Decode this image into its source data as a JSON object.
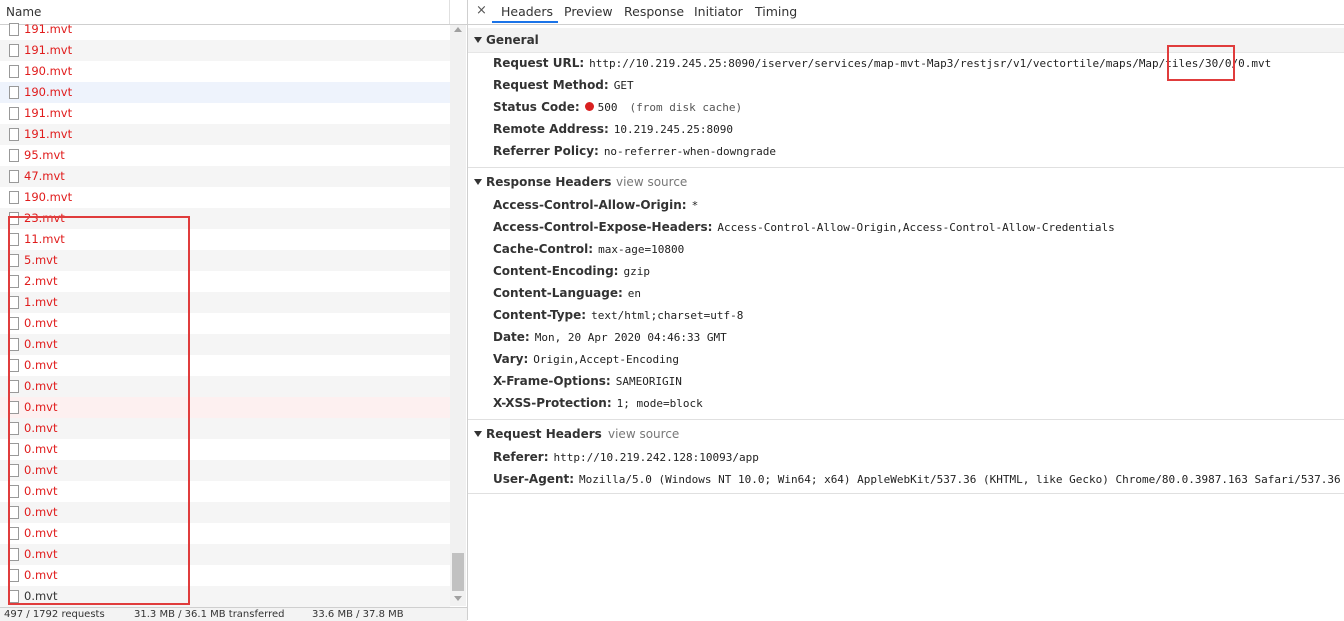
{
  "network_list": {
    "column_name": "Name",
    "files": [
      {
        "name": "191.mvt",
        "style": "red"
      },
      {
        "name": "191.mvt",
        "style": "red"
      },
      {
        "name": "190.mvt",
        "style": "red"
      },
      {
        "name": "190.mvt",
        "style": "red-selected"
      },
      {
        "name": "191.mvt",
        "style": "red"
      },
      {
        "name": "191.mvt",
        "style": "red"
      },
      {
        "name": "95.mvt",
        "style": "red"
      },
      {
        "name": "47.mvt",
        "style": "red"
      },
      {
        "name": "190.mvt",
        "style": "red"
      },
      {
        "name": "23.mvt",
        "style": "red"
      },
      {
        "name": "11.mvt",
        "style": "red"
      },
      {
        "name": "5.mvt",
        "style": "red"
      },
      {
        "name": "2.mvt",
        "style": "red"
      },
      {
        "name": "1.mvt",
        "style": "red"
      },
      {
        "name": "0.mvt",
        "style": "red"
      },
      {
        "name": "0.mvt",
        "style": "red"
      },
      {
        "name": "0.mvt",
        "style": "red"
      },
      {
        "name": "0.mvt",
        "style": "red"
      },
      {
        "name": "0.mvt",
        "style": "red-error"
      },
      {
        "name": "0.mvt",
        "style": "red"
      },
      {
        "name": "0.mvt",
        "style": "red"
      },
      {
        "name": "0.mvt",
        "style": "red"
      },
      {
        "name": "0.mvt",
        "style": "red"
      },
      {
        "name": "0.mvt",
        "style": "red"
      },
      {
        "name": "0.mvt",
        "style": "red"
      },
      {
        "name": "0.mvt",
        "style": "red"
      },
      {
        "name": "0.mvt",
        "style": "red"
      },
      {
        "name": "0.mvt",
        "style": "black"
      }
    ],
    "status_bar": {
      "requests": "497 / 1792 requests",
      "transferred": "31.3 MB / 36.1 MB transferred",
      "resources": "33.6 MB / 37.8 MB"
    }
  },
  "detail": {
    "close_icon": "×",
    "tabs": [
      "Headers",
      "Preview",
      "Response",
      "Initiator",
      "Timing"
    ],
    "active_tab": "Headers",
    "general": {
      "title": "General",
      "rows": [
        {
          "name": "Request URL:",
          "value": "http://10.219.245.25:8090/iserver/services/map-mvt-Map3/restjsr/v1/vectortile/maps/Map/tiles/30/0/0.mvt"
        },
        {
          "name": "Request Method:",
          "value": "GET"
        },
        {
          "name": "Status Code:",
          "value": "500",
          "note": "(from disk cache)",
          "status_color": "#d92020"
        },
        {
          "name": "Remote Address:",
          "value": "10.219.245.25:8090"
        },
        {
          "name": "Referrer Policy:",
          "value": "no-referrer-when-downgrade"
        }
      ]
    },
    "response_headers": {
      "title": "Response Headers",
      "view_source": "view source",
      "rows": [
        {
          "name": "Access-Control-Allow-Origin:",
          "value": "*"
        },
        {
          "name": "Access-Control-Expose-Headers:",
          "value": "Access-Control-Allow-Origin,Access-Control-Allow-Credentials"
        },
        {
          "name": "Cache-Control:",
          "value": "max-age=10800"
        },
        {
          "name": "Content-Encoding:",
          "value": "gzip"
        },
        {
          "name": "Content-Language:",
          "value": "en"
        },
        {
          "name": "Content-Type:",
          "value": "text/html;charset=utf-8"
        },
        {
          "name": "Date:",
          "value": "Mon, 20 Apr 2020 04:46:33 GMT"
        },
        {
          "name": "Vary:",
          "value": "Origin,Accept-Encoding"
        },
        {
          "name": "X-Frame-Options:",
          "value": "SAMEORIGIN"
        },
        {
          "name": "X-XSS-Protection:",
          "value": "1; mode=block"
        }
      ]
    },
    "request_headers": {
      "title": "Request Headers",
      "view_source": "view source",
      "rows": [
        {
          "name": "Referer:",
          "value": "http://10.219.242.128:10093/app"
        },
        {
          "name": "User-Agent:",
          "value": "Mozilla/5.0 (Windows NT 10.0; Win64; x64) AppleWebKit/537.36 (KHTML, like Gecko) Chrome/80.0.3987.163 Safari/537.36"
        }
      ]
    }
  },
  "colors": {
    "error_red": "#e01b1b",
    "accent_blue": "#1a73e8",
    "annotation_red": "#e03c3c"
  }
}
